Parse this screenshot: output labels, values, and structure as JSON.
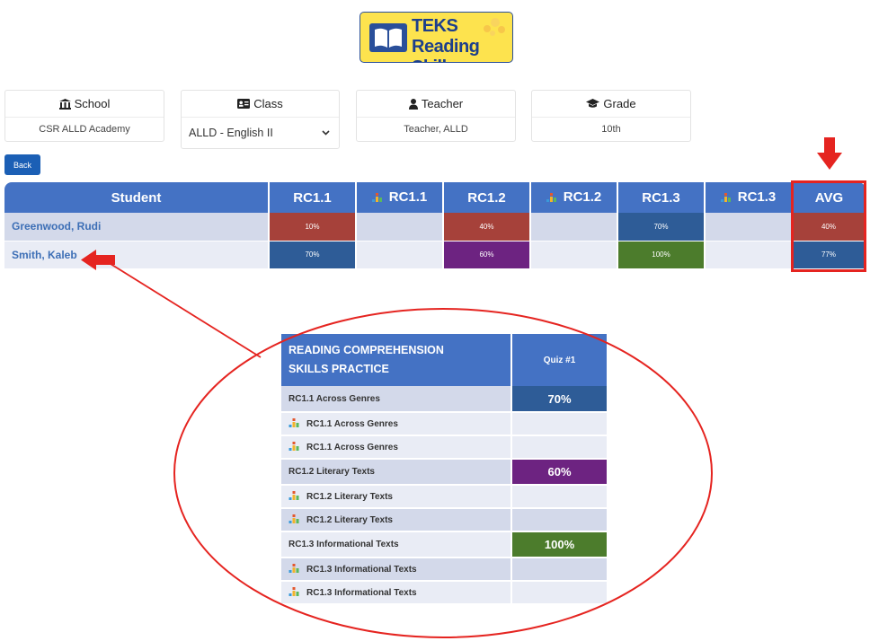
{
  "logo": {
    "line1": "TEKS",
    "line2": "Reading Skills"
  },
  "cards": {
    "school": {
      "label": "School",
      "value": "CSR ALLD Academy"
    },
    "class": {
      "label": "Class",
      "value": "ALLD - English II"
    },
    "teacher": {
      "label": "Teacher",
      "value": "Teacher, ALLD"
    },
    "grade": {
      "label": "Grade",
      "value": "10th"
    }
  },
  "back_label": "Back",
  "grid": {
    "headers": [
      "Student",
      "RC1.1",
      "RC1.1",
      "RC1.2",
      "RC1.2",
      "RC1.3",
      "RC1.3",
      "AVG"
    ],
    "rows": [
      {
        "name": "Greenwood, Rudi",
        "cells": [
          "10%",
          "",
          "40%",
          "",
          "70%",
          "",
          "40%"
        ]
      },
      {
        "name": "Smith, Kaleb",
        "cells": [
          "70%",
          "",
          "60%",
          "",
          "100%",
          "",
          "77%"
        ]
      }
    ]
  },
  "callout": {
    "title_line1": "READING COMPREHENSION",
    "title_line2": "SKILLS PRACTICE",
    "quiz_header": "Quiz #1",
    "rows": [
      {
        "label": "RC1.1 Across Genres",
        "score": "70%"
      },
      {
        "label": "RC1.1 Across Genres",
        "score": ""
      },
      {
        "label": "RC1.1 Across Genres",
        "score": ""
      },
      {
        "label": "RC1.2 Literary Texts",
        "score": "60%"
      },
      {
        "label": "RC1.2 Literary Texts",
        "score": ""
      },
      {
        "label": "RC1.2 Literary Texts",
        "score": ""
      },
      {
        "label": "RC1.3 Informational Texts",
        "score": "100%"
      },
      {
        "label": "RC1.3 Informational Texts",
        "score": ""
      },
      {
        "label": "RC1.3 Informational Texts",
        "score": ""
      }
    ]
  },
  "colors": {
    "header_blue": "#4472c4",
    "score_red": "#a6413a",
    "score_blue": "#2e5c97",
    "score_purple": "#6d2381",
    "score_green": "#4c7c2c",
    "annotation_red": "#e52420"
  }
}
